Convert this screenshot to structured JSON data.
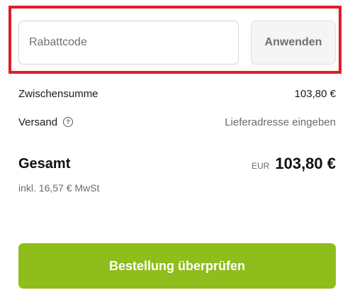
{
  "discount": {
    "placeholder": "Rabattcode",
    "value": "",
    "apply_label": "Anwenden"
  },
  "summary": {
    "subtotal_label": "Zwischensumme",
    "subtotal_value": "103,80 €",
    "shipping_label": "Versand",
    "shipping_help_icon": "question-circle-icon",
    "shipping_value": "Lieferadresse eingeben",
    "total_label": "Gesamt",
    "currency": "EUR",
    "total_value": "103,80 €",
    "tax_note": "inkl. 16,57 € MwSt"
  },
  "checkout": {
    "button_label": "Bestellung überprüfen"
  },
  "colors": {
    "highlight_border": "#e01d2a",
    "checkout_button": "#8fbd1b",
    "muted_text": "#6b6b6b"
  }
}
